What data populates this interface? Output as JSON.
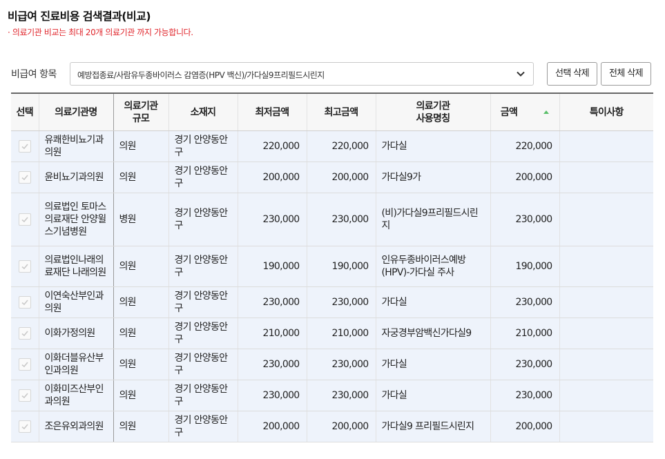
{
  "page": {
    "title": "비급여 진료비용 검색결과(비교)",
    "notice": "· 의료기관 비교는 최대 20개 의료기관 까지 가능합니다."
  },
  "filter": {
    "label": "비급여 항목",
    "selected": "예방접종료/사람유두종바이러스 감염증(HPV 백신)/가다실9프리필드시린지"
  },
  "buttons": {
    "delete_selected": "선택 삭제",
    "delete_all": "전체 삭제"
  },
  "table": {
    "headers": {
      "select": "선택",
      "name": "의료기관명",
      "scale_line1": "의료기관",
      "scale_line2": "규모",
      "location": "소재지",
      "min_price": "최저금액",
      "max_price": "최고금액",
      "usage_line1": "의료기관",
      "usage_line2": "사용명칭",
      "price": "금액",
      "notes": "특이사항"
    },
    "sort": {
      "column": "price",
      "direction": "ascending",
      "color": "#5bbf6a"
    },
    "rows": [
      {
        "name": "유쾌한비뇨기과의원",
        "scale": "의원",
        "location": "경기 안양동안구",
        "min": "220,000",
        "max": "220,000",
        "usage": "가다실",
        "price": "220,000",
        "notes": ""
      },
      {
        "name": "윤비뇨기과의원",
        "scale": "의원",
        "location": "경기 안양동안구",
        "min": "200,000",
        "max": "200,000",
        "usage": "가다실9가",
        "price": "200,000",
        "notes": ""
      },
      {
        "name": "의료법인 토마스의료재단 안양윌스기념병원",
        "scale": "병원",
        "location": "경기 안양동안구",
        "min": "230,000",
        "max": "230,000",
        "usage": "(비)가다실9프리필드시린지",
        "price": "230,000",
        "notes": ""
      },
      {
        "name": "의료법인나래의료재단 나래의원",
        "scale": "의원",
        "location": "경기 안양동안구",
        "min": "190,000",
        "max": "190,000",
        "usage": "인유두종바이러스예방(HPV)-가다실 주사",
        "price": "190,000",
        "notes": ""
      },
      {
        "name": "이연숙산부인과의원",
        "scale": "의원",
        "location": "경기 안양동안구",
        "min": "230,000",
        "max": "230,000",
        "usage": "가다실",
        "price": "230,000",
        "notes": ""
      },
      {
        "name": "이화가정의원",
        "scale": "의원",
        "location": "경기 안양동안구",
        "min": "210,000",
        "max": "210,000",
        "usage": "자궁경부암백신가다실9",
        "price": "210,000",
        "notes": ""
      },
      {
        "name": "이화더블유산부인과의원",
        "scale": "의원",
        "location": "경기 안양동안구",
        "min": "230,000",
        "max": "230,000",
        "usage": "가다실",
        "price": "230,000",
        "notes": ""
      },
      {
        "name": "이화미즈산부인과의원",
        "scale": "의원",
        "location": "경기 안양동안구",
        "min": "230,000",
        "max": "230,000",
        "usage": "가다실",
        "price": "230,000",
        "notes": ""
      },
      {
        "name": "조은유외과의원",
        "scale": "의원",
        "location": "경기 안양동안구",
        "min": "200,000",
        "max": "200,000",
        "usage": "가다실9 프리필드시린지",
        "price": "200,000",
        "notes": ""
      }
    ]
  },
  "colors": {
    "notice": "#e0252b",
    "row_background": "#eef3fb",
    "header_background": "#f7f7f7"
  },
  "icons": {
    "dropdown": "chevron-down-icon",
    "checkbox": "check-icon",
    "sort": "sort-asc-icon"
  }
}
